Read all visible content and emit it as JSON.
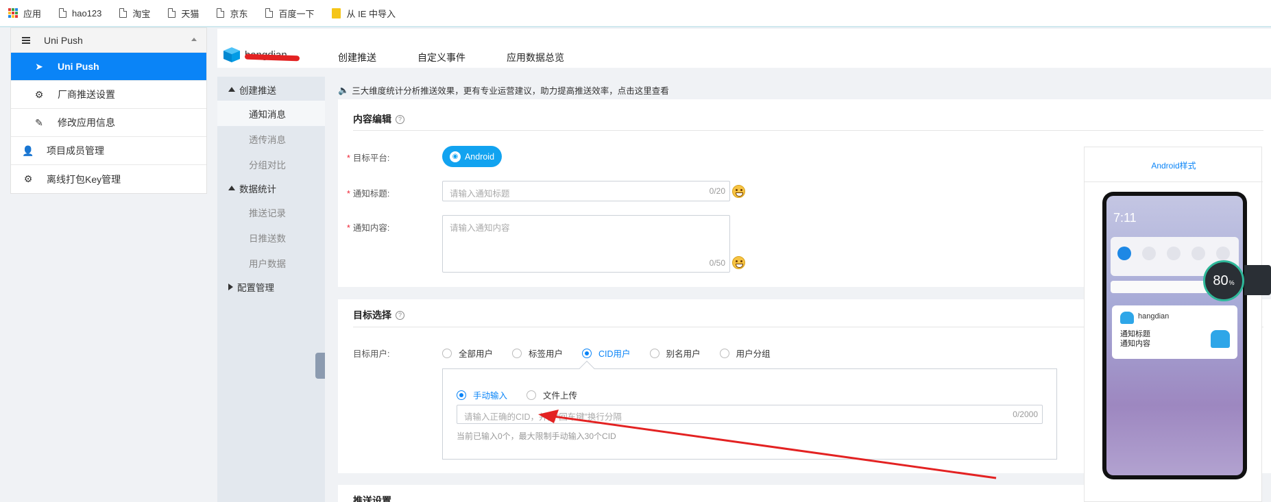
{
  "bookmarks": [
    {
      "label": "应用",
      "icon": "apps-icon"
    },
    {
      "label": "hao123",
      "icon": "page-icon"
    },
    {
      "label": "淘宝",
      "icon": "page-icon"
    },
    {
      "label": "天猫",
      "icon": "page-icon"
    },
    {
      "label": "京东",
      "icon": "page-icon"
    },
    {
      "label": "百度一下",
      "icon": "page-icon"
    },
    {
      "label": "从 IE 中导入",
      "icon": "folder-icon"
    }
  ],
  "leftnav": {
    "header": "Uni Push",
    "items": [
      {
        "label": "Uni Push",
        "icon": "send-icon",
        "active": true
      },
      {
        "label": "厂商推送设置",
        "icon": "gear-icon"
      },
      {
        "label": "修改应用信息",
        "icon": "edit-icon"
      }
    ],
    "top_items": [
      {
        "label": "项目成员管理",
        "icon": "user-icon"
      },
      {
        "label": "离线打包Key管理",
        "icon": "gear-icon"
      }
    ]
  },
  "header": {
    "app_name": "hangdian",
    "tabs": [
      "创建推送",
      "自定义事件",
      "应用数据总览"
    ]
  },
  "subnav": {
    "group1": "创建推送",
    "group1_items": [
      "通知消息",
      "透传消息",
      "分组对比"
    ],
    "group2": "数据统计",
    "group2_items": [
      "推送记录",
      "日推送数",
      "用户数据"
    ],
    "group3": "配置管理"
  },
  "notice": "三大维度统计分析推送效果，更有专业运营建议，助力提高推送效率，点击这里查看",
  "content_edit": {
    "title": "内容编辑",
    "platform_label": "目标平台:",
    "platform_button": "Android",
    "title_label": "通知标题:",
    "title_placeholder": "请输入通知标题",
    "title_count": "0/20",
    "body_label": "通知内容:",
    "body_placeholder": "请输入通知内容",
    "body_count": "0/50"
  },
  "target": {
    "title": "目标选择",
    "users_label": "目标用户:",
    "options": [
      "全部用户",
      "标签用户",
      "CID用户",
      "别名用户",
      "用户分组"
    ],
    "selected": "CID用户",
    "input_modes": [
      "手动输入",
      "文件上传"
    ],
    "cid_placeholder": "请输入正确的CID，并按“回车键”换行分隔",
    "cid_count": "0/2000",
    "hint": "当前已输入0个，最大限制手动输入30个CID"
  },
  "push_settings": {
    "title": "推送设置"
  },
  "preview": {
    "title": "Android样式",
    "time": "7:11",
    "notif_app": "hangdian",
    "notif_title": "通知标题",
    "notif_body": "通知内容",
    "gauge_value": "80",
    "gauge_unit": "%"
  },
  "colors": {
    "accent": "#0a84f7",
    "android_btn": "#12a3f0",
    "annotation_arrow": "#e32222"
  }
}
